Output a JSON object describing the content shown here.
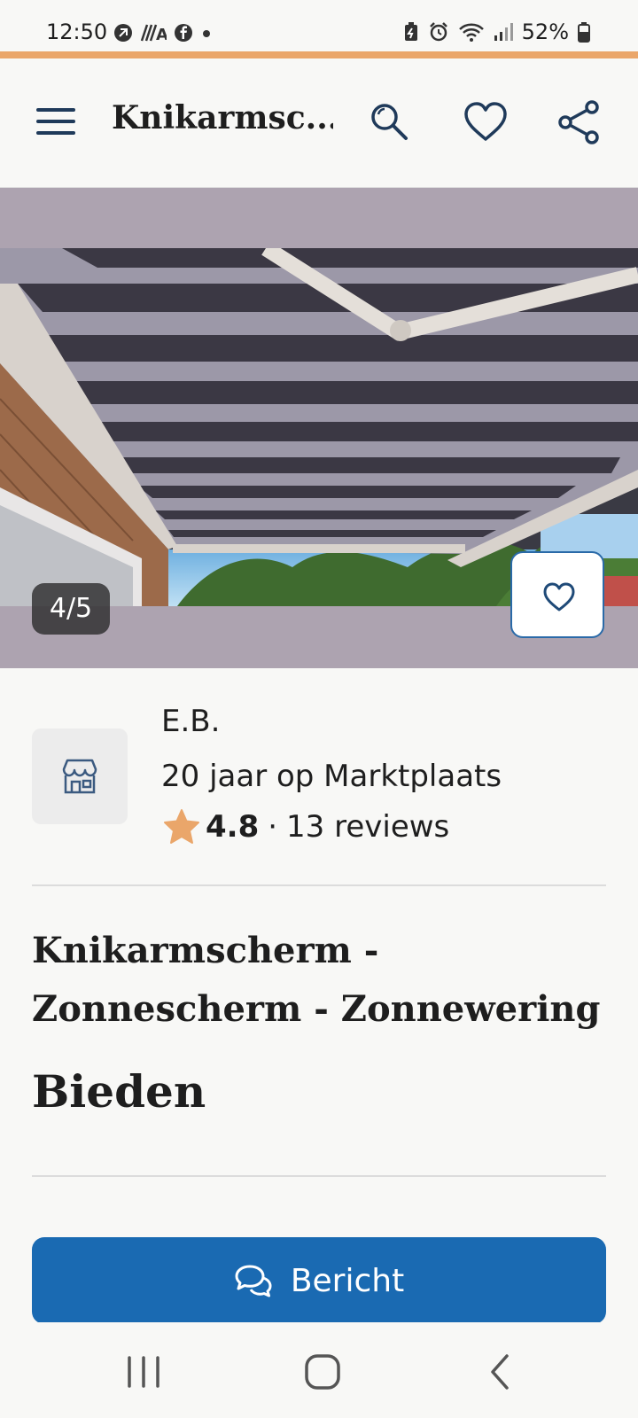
{
  "status_bar": {
    "time": "12:50",
    "battery": "52%"
  },
  "header": {
    "title": "Knikarmsc...",
    "menu_icon": "hamburger-menu-icon",
    "search_icon": "search-icon",
    "favorite_icon": "heart-icon",
    "share_icon": "share-icon"
  },
  "photo": {
    "counter": "4/5",
    "favorite_icon": "heart-icon"
  },
  "seller": {
    "avatar_icon": "shop-icon",
    "name": "E.B.",
    "since": "20 jaar op Marktplaats",
    "rating": "4.8",
    "separator": "·",
    "reviews": "13 reviews"
  },
  "listing": {
    "title": "Knikarmscherm - Zonnescherm - Zonnewering",
    "price": "Bieden"
  },
  "actions": {
    "message_label": "Bericht",
    "message_icon": "chat-bubbles-icon"
  },
  "colors": {
    "accent": "#eaa66a",
    "primary_button": "#1a6ab2",
    "star": "#eaa66a"
  }
}
